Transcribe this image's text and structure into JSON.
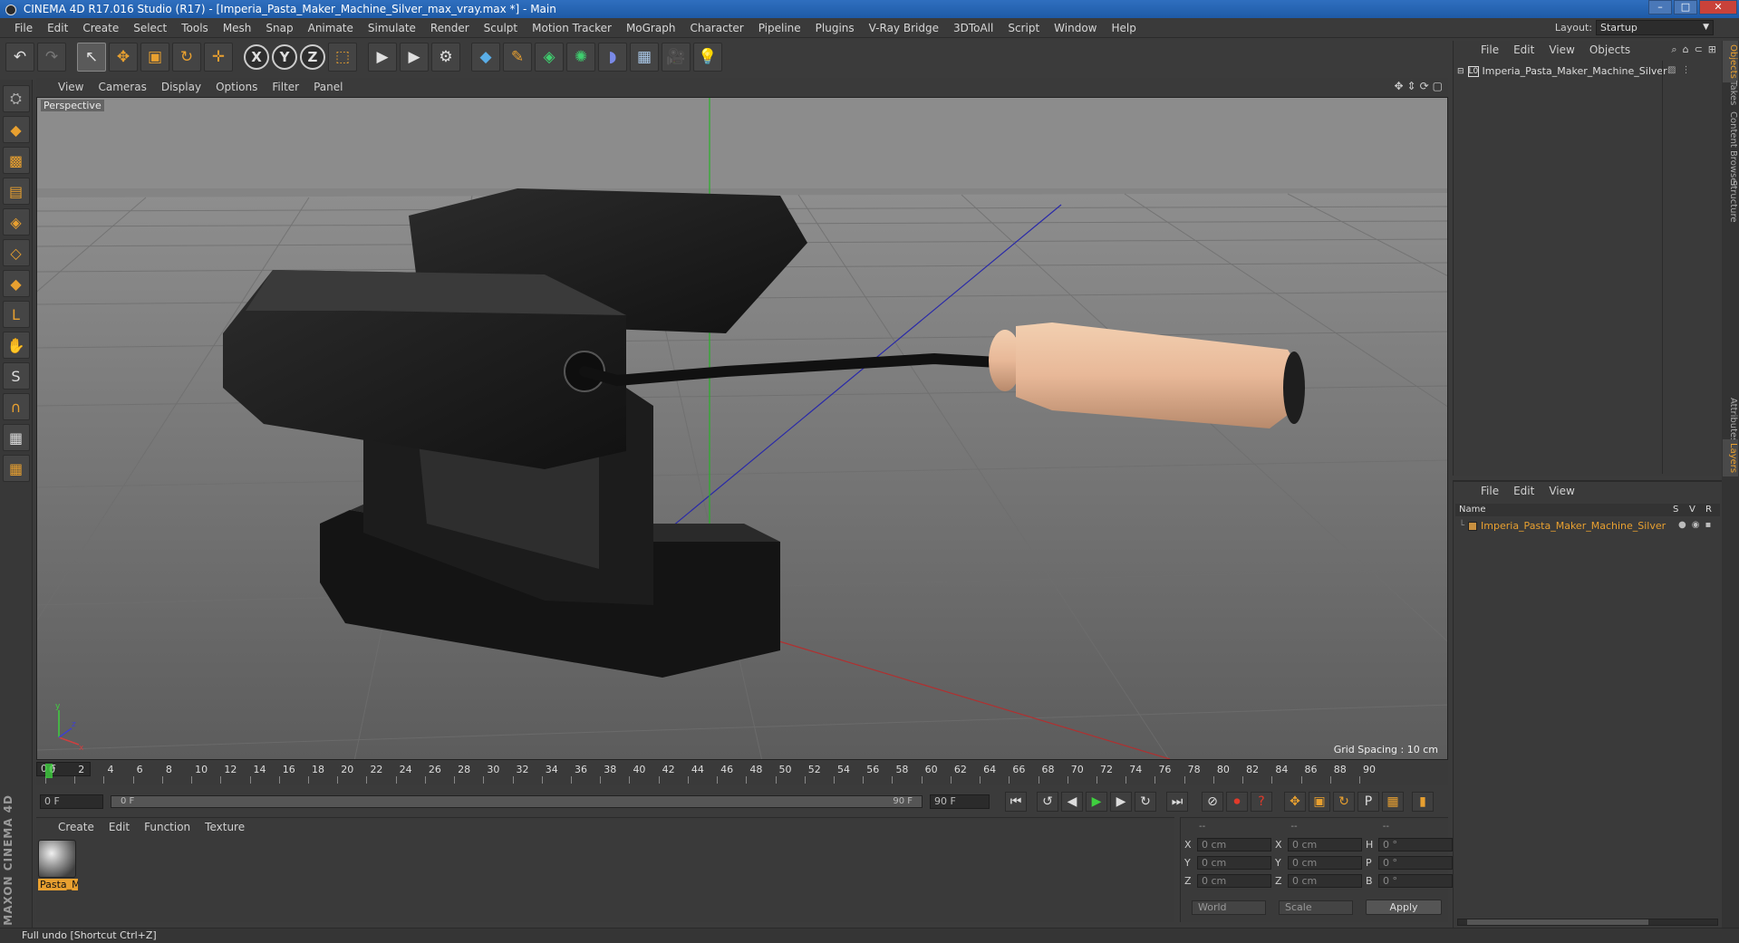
{
  "window": {
    "title": "CINEMA 4D R17.016 Studio (R17) - [Imperia_Pasta_Maker_Machine_Silver_max_vray.max *] - Main",
    "controls": {
      "minimize": "–",
      "maximize": "□",
      "close": "✕"
    }
  },
  "menubar": {
    "items": [
      "File",
      "Edit",
      "Create",
      "Select",
      "Tools",
      "Mesh",
      "Snap",
      "Animate",
      "Simulate",
      "Render",
      "Sculpt",
      "Motion Tracker",
      "MoGraph",
      "Character",
      "Pipeline",
      "Plugins",
      "V-Ray Bridge",
      "3DToAll",
      "Script",
      "Window",
      "Help"
    ]
  },
  "layout": {
    "label": "Layout:",
    "value": "Startup"
  },
  "toolbar": {
    "undo": "↶",
    "redo": "↷",
    "select": "↖",
    "move": "✥",
    "scale": "▣",
    "rotate": "↻",
    "move2": "✛",
    "x_axis": "X",
    "y_axis": "Y",
    "z_axis": "Z",
    "coord": "⬚",
    "render_view": "▶",
    "render_pv": "▶",
    "render_settings": "⚙",
    "cube": "◆",
    "pen": "✎",
    "subdiv": "◈",
    "array": "✺",
    "deformer": "◗",
    "floor": "▦",
    "camera": "🎥",
    "light": "💡"
  },
  "viewport": {
    "menus": [
      "View",
      "Cameras",
      "Display",
      "Options",
      "Filter",
      "Panel"
    ],
    "label": "Perspective",
    "grid_spacing": "Grid Spacing : 10 cm",
    "nav_icons": [
      "✥",
      "⇕",
      "⟳",
      "▢"
    ]
  },
  "timeline": {
    "ticks": [
      "0",
      "2",
      "4",
      "6",
      "8",
      "10",
      "12",
      "14",
      "16",
      "18",
      "20",
      "22",
      "24",
      "26",
      "28",
      "30",
      "32",
      "34",
      "36",
      "38",
      "40",
      "42",
      "44",
      "46",
      "48",
      "50",
      "52",
      "54",
      "56",
      "58",
      "60",
      "62",
      "64",
      "66",
      "68",
      "70",
      "72",
      "74",
      "76",
      "78",
      "80",
      "82",
      "84",
      "86",
      "88",
      "90"
    ],
    "current_frame": "0 F"
  },
  "transport": {
    "start_field": "0 F",
    "range_start": "0 F",
    "range_end": "90 F",
    "end_field": "90 F",
    "btn_first": "⏮",
    "btn_prev_key": "↺",
    "btn_prev": "◀",
    "btn_play": "▶",
    "btn_next": "▶",
    "btn_next_key": "↻",
    "btn_last": "⏭",
    "btn_keyframe": "⊘",
    "btn_record": "⏺",
    "btn_help": "?",
    "btn_move": "✥",
    "btn_scale": "▣",
    "btn_rotate": "↻",
    "btn_param": "P",
    "btn_grid": "▦",
    "btn_timeline": "▮"
  },
  "materials": {
    "menus": [
      "Create",
      "Edit",
      "Function",
      "Texture"
    ],
    "items": [
      {
        "name": "Pasta_M"
      }
    ]
  },
  "coordinates": {
    "headers": [
      "--",
      "--",
      "--"
    ],
    "rows": [
      {
        "a": "X",
        "av": "0 cm",
        "b": "X",
        "bv": "0 cm",
        "c": "H",
        "cv": "0 °"
      },
      {
        "a": "Y",
        "av": "0 cm",
        "b": "Y",
        "bv": "0 cm",
        "c": "P",
        "cv": "0 °"
      },
      {
        "a": "Z",
        "av": "0 cm",
        "b": "Z",
        "bv": "0 cm",
        "c": "B",
        "cv": "0 °"
      }
    ],
    "mode": "World",
    "scale": "Scale",
    "apply": "Apply"
  },
  "objects_panel": {
    "menus": [
      "File",
      "Edit",
      "View",
      "Objects"
    ],
    "object_name": "Imperia_Pasta_Maker_Machine_Silver"
  },
  "layers_panel": {
    "menus": [
      "File",
      "Edit",
      "View"
    ],
    "columns": {
      "name": "Name",
      "s": "S",
      "v": "V",
      "r": "R"
    },
    "layer_name": "Imperia_Pasta_Maker_Machine_Silver"
  },
  "right_tabs": [
    "Objects",
    "Takes",
    "Content Browser",
    "Structure",
    "Attributes",
    "Layers"
  ],
  "status": "Full undo [Shortcut Ctrl+Z]",
  "brand": "MAXON CINEMA 4D",
  "colors": {
    "accent": "#e8a030",
    "play": "#3fcf3f",
    "record": "#e23a2a"
  }
}
